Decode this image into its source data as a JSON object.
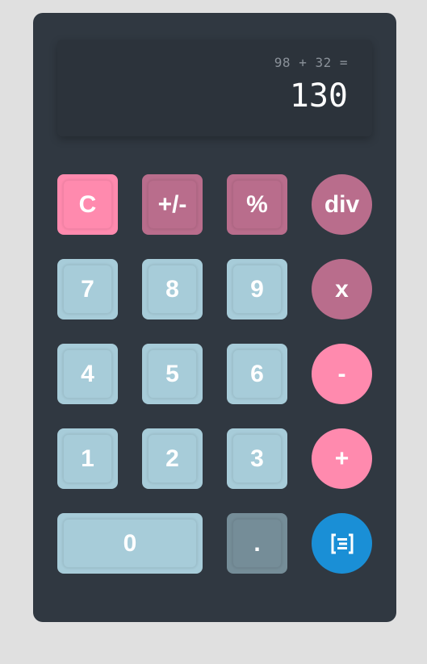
{
  "display": {
    "expression": "98 + 32 =",
    "result": "130"
  },
  "keys": {
    "clear": "C",
    "negate": "+/-",
    "percent": "%",
    "divide": "div",
    "seven": "7",
    "eight": "8",
    "nine": "9",
    "multiply": "x",
    "four": "4",
    "five": "5",
    "six": "6",
    "subtract": "-",
    "one": "1",
    "two": "2",
    "three": "3",
    "add": "+",
    "zero": "0",
    "decimal": ".",
    "equals_icon": "equals-icon"
  },
  "colors": {
    "body_background": "#e0e0e0",
    "calculator": "#303841",
    "display": "#2c333b",
    "number_key": "#a7ccd9",
    "decimal_key": "#758d98",
    "pink_key": "#ff8aae",
    "mauve_key": "#b96d8c",
    "equals_key": "#1a8fd6"
  }
}
